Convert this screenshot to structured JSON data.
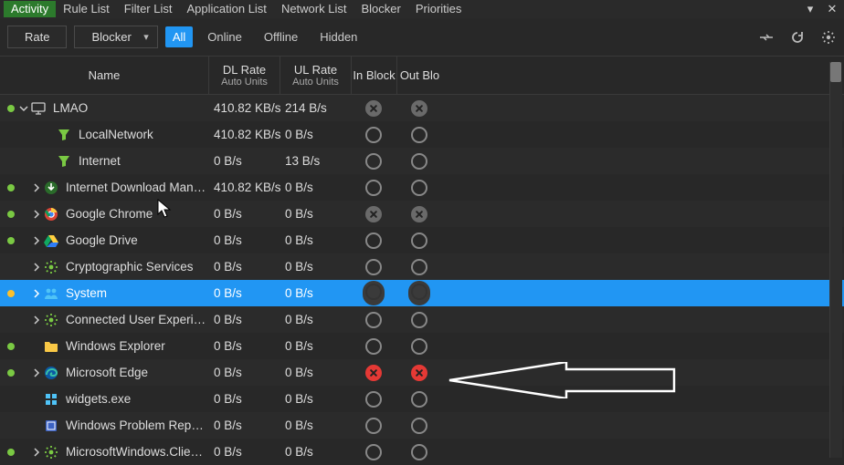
{
  "menubar": {
    "tabs": [
      "Activity",
      "Rule List",
      "Filter List",
      "Application List",
      "Network List",
      "Blocker",
      "Priorities"
    ],
    "active_index": 0
  },
  "toolbar": {
    "rate_btn": "Rate",
    "blocker_btn": "Blocker",
    "filters": [
      "All",
      "Online",
      "Offline",
      "Hidden"
    ],
    "active_filter_index": 0
  },
  "columns": {
    "name": "Name",
    "dl": "DL Rate",
    "dl_sub": "Auto Units",
    "ul": "UL Rate",
    "ul_sub": "Auto Units",
    "inblock": "In Block",
    "outblock": "Out Blo"
  },
  "rows": [
    {
      "dot": "green",
      "expand": "down",
      "indent": 0,
      "icon": "monitor",
      "label": "LMAO",
      "dl": "410.82 KB/s",
      "ul": "214 B/s",
      "in": "grey-x",
      "out": "grey-x"
    },
    {
      "dot": "none",
      "expand": "",
      "indent": 2,
      "icon": "filter",
      "label": "LocalNetwork",
      "dl": "410.82 KB/s",
      "ul": "0 B/s",
      "in": "empty",
      "out": "empty"
    },
    {
      "dot": "none",
      "expand": "",
      "indent": 2,
      "icon": "filter",
      "label": "Internet",
      "dl": "0 B/s",
      "ul": "13 B/s",
      "in": "empty",
      "out": "empty"
    },
    {
      "dot": "green",
      "expand": "right",
      "indent": 1,
      "icon": "idm",
      "label": "Internet Download Manager (",
      "dl": "410.82 KB/s",
      "ul": "0 B/s",
      "in": "empty",
      "out": "empty"
    },
    {
      "dot": "green",
      "expand": "right",
      "indent": 1,
      "icon": "chrome",
      "label": "Google Chrome",
      "dl": "0 B/s",
      "ul": "0 B/s",
      "in": "grey-x",
      "out": "grey-x"
    },
    {
      "dot": "green",
      "expand": "right",
      "indent": 1,
      "icon": "gdrive",
      "label": "Google Drive",
      "dl": "0 B/s",
      "ul": "0 B/s",
      "in": "empty",
      "out": "empty"
    },
    {
      "dot": "none",
      "expand": "right",
      "indent": 1,
      "icon": "gear",
      "label": "Cryptographic Services",
      "dl": "0 B/s",
      "ul": "0 B/s",
      "in": "empty",
      "out": "empty"
    },
    {
      "dot": "yellow",
      "expand": "right",
      "indent": 1,
      "icon": "people",
      "label": "System",
      "dl": "0 B/s",
      "ul": "0 B/s",
      "in": "empty",
      "out": "empty",
      "selected": true
    },
    {
      "dot": "none",
      "expand": "right",
      "indent": 1,
      "icon": "gear",
      "label": "Connected User Experiences a",
      "dl": "0 B/s",
      "ul": "0 B/s",
      "in": "empty",
      "out": "empty"
    },
    {
      "dot": "green",
      "expand": "",
      "indent": 1,
      "icon": "folder",
      "label": "Windows Explorer",
      "dl": "0 B/s",
      "ul": "0 B/s",
      "in": "empty",
      "out": "empty"
    },
    {
      "dot": "green",
      "expand": "right",
      "indent": 1,
      "icon": "edge",
      "label": "Microsoft Edge",
      "dl": "0 B/s",
      "ul": "0 B/s",
      "in": "red-x",
      "out": "red-x"
    },
    {
      "dot": "none",
      "expand": "",
      "indent": 1,
      "icon": "widget",
      "label": "widgets.exe",
      "dl": "0 B/s",
      "ul": "0 B/s",
      "in": "empty",
      "out": "empty"
    },
    {
      "dot": "none",
      "expand": "",
      "indent": 1,
      "icon": "wer",
      "label": "Windows Problem Reporting",
      "dl": "0 B/s",
      "ul": "0 B/s",
      "in": "empty",
      "out": "empty"
    },
    {
      "dot": "green",
      "expand": "right",
      "indent": 1,
      "icon": "gear",
      "label": "MicrosoftWindows.Client.CBS",
      "dl": "0 B/s",
      "ul": "0 B/s",
      "in": "empty",
      "out": "empty"
    }
  ]
}
